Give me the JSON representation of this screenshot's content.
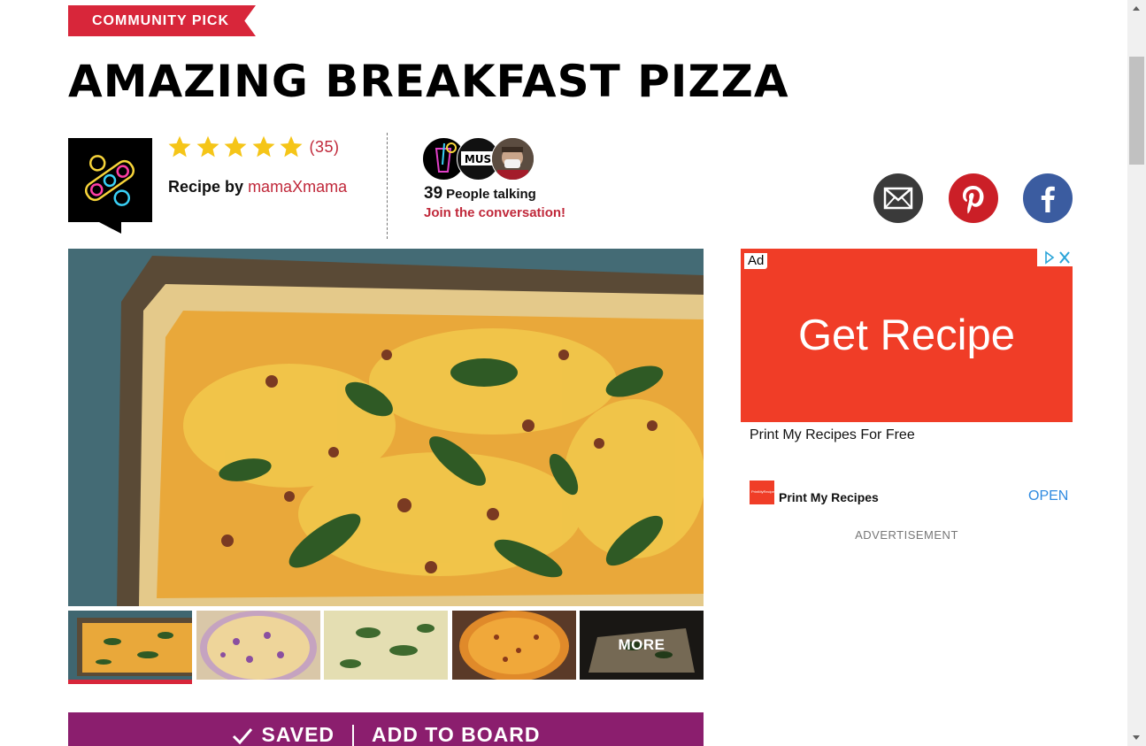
{
  "badge": {
    "label": "COMMUNITY PICK"
  },
  "recipe": {
    "title": "AMAZING BREAKFAST PIZZA",
    "rating": {
      "stars": 5,
      "count_label": "(35)"
    },
    "recipe_by_prefix": "Recipe by",
    "author": "mamaXmama"
  },
  "conversation": {
    "count": "39",
    "people_label": "People talking",
    "join_label": "Join the conversation!",
    "avatar2_text": "MUS"
  },
  "share": {
    "email_icon": "envelope-icon",
    "pinterest_icon": "pinterest-icon",
    "facebook_icon": "facebook-icon"
  },
  "gallery": {
    "more_label": "MORE",
    "active_index": 0
  },
  "actions": {
    "saved_label": "SAVED",
    "add_to_board_label": "ADD TO BOARD"
  },
  "ad": {
    "tag": "Ad",
    "headline": "Get Recipe",
    "subline": "Print My Recipes For Free",
    "brand": "Print My Recipes",
    "cta": "OPEN",
    "advertisement_label": "ADVERTISEMENT",
    "color": "#f03d27"
  },
  "colors": {
    "accent": "#d8263a",
    "save_bar": "#8b1e6e",
    "star": "#f5c518"
  }
}
